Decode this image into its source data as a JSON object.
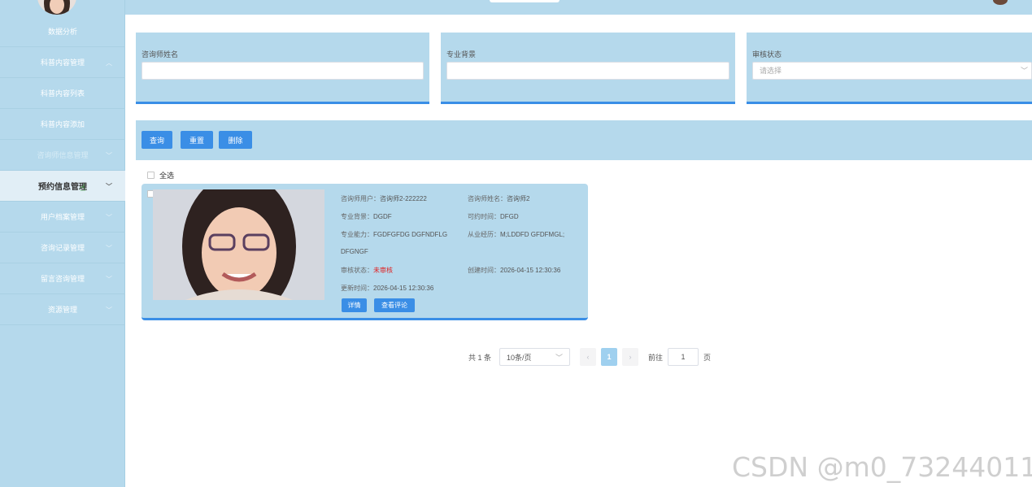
{
  "sidebar": {
    "items": [
      {
        "label": "数据分析",
        "chevron": false
      },
      {
        "label": "科普内容管理",
        "chevron": true
      },
      {
        "label": "科普内容列表",
        "chevron": false
      },
      {
        "label": "科普内容添加",
        "chevron": false
      },
      {
        "label": "咨询师信息管理",
        "chevron": true
      },
      {
        "label": "预约信息管理",
        "chevron": true
      },
      {
        "label": "用户档案管理",
        "chevron": true
      },
      {
        "label": "咨询记录管理",
        "chevron": true
      },
      {
        "label": "留言咨询管理",
        "chevron": true
      },
      {
        "label": "资源管理",
        "chevron": true
      }
    ],
    "active_index": 5
  },
  "filters": {
    "name": {
      "label": "咨询师姓名",
      "value": ""
    },
    "background": {
      "label": "专业背景",
      "value": ""
    },
    "status": {
      "label": "审核状态",
      "placeholder": "请选择"
    }
  },
  "actions": {
    "query": "查询",
    "reset": "重置",
    "delete": "删除"
  },
  "select_all": "全选",
  "card": {
    "user_label": "咨询师用户：",
    "user": "咨询师2-222222",
    "name_label": "咨询师姓名：",
    "name": "咨询师2",
    "bg_label": "专业背景：",
    "bg": "DGDF",
    "time_label": "可约时间：",
    "time": "DFGD",
    "ability_label": "专业能力：",
    "ability": "FGDFGFDG DGFNDFLG",
    "ability_cont": "DFGNGF",
    "exp_label": "从业经历：",
    "exp": "M;LDDFD GFDFMGL;",
    "status_label": "审核状态：",
    "status": "未审核",
    "created_label": "创建时间：",
    "created": "2026-04-15 12:30:36",
    "updated_label": "更新时间：",
    "updated": "2026-04-15 12:30:36",
    "detail_btn": "详情",
    "review_btn": "查看评论"
  },
  "pagination": {
    "total": "共 1 条",
    "page_size": "10条/页",
    "current": "1",
    "goto_label": "前往",
    "goto_value": "1",
    "page_unit": "页"
  },
  "watermark": "CSDN @m0_73244011",
  "colors": {
    "accent": "#3a8ee6",
    "panel": "#b5d9ec",
    "status_red": "#e02020"
  }
}
